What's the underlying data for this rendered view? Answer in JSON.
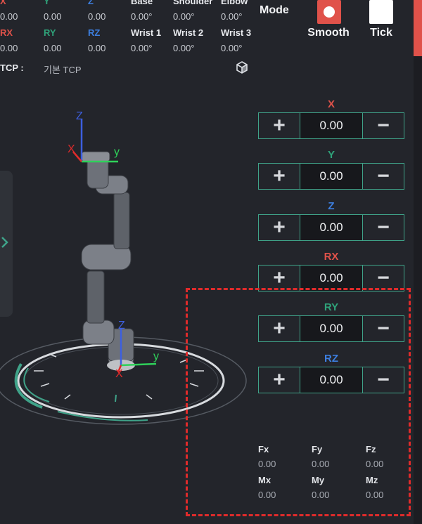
{
  "top_grid": {
    "row1_labels": [
      "X",
      "Y",
      "Z",
      "Base",
      "Shoulder",
      "Elbow"
    ],
    "row1_values": [
      "0.00",
      "0.00",
      "0.00",
      "0.00°",
      "0.00°",
      "0.00°"
    ],
    "row2_labels": [
      "RX",
      "RY",
      "RZ",
      "Wrist 1",
      "Wrist 2",
      "Wrist 3"
    ],
    "row2_values": [
      "0.00",
      "0.00",
      "0.00",
      "0.00°",
      "0.00°",
      "0.00°"
    ]
  },
  "tcp": {
    "label": "TCP :",
    "value": "기본 TCP",
    "icon": "cube-icon"
  },
  "mode": {
    "label": "Mode",
    "options": [
      {
        "label": "Smooth",
        "selected": true
      },
      {
        "label": "Tick",
        "selected": false
      }
    ]
  },
  "robot_view": {
    "tool_axes": {
      "z": "Z",
      "x": "X",
      "y": "y"
    },
    "base_axes": {
      "z": "Z",
      "x": "X",
      "y": "y"
    }
  },
  "jog": [
    {
      "axis": "X",
      "value": "0.00",
      "color": "#e0524a"
    },
    {
      "axis": "Y",
      "value": "0.00",
      "color": "#2fa37a"
    },
    {
      "axis": "Z",
      "value": "0.00",
      "color": "#3d7fe0"
    },
    {
      "axis": "RX",
      "value": "0.00",
      "color": "#e0524a"
    },
    {
      "axis": "RY",
      "value": "0.00",
      "color": "#2fa37a"
    },
    {
      "axis": "RZ",
      "value": "0.00",
      "color": "#3d7fe0"
    }
  ],
  "force_torque": {
    "row1": [
      {
        "label": "Fx",
        "value": "0.00"
      },
      {
        "label": "Fy",
        "value": "0.00"
      },
      {
        "label": "Fz",
        "value": "0.00"
      }
    ],
    "row2": [
      {
        "label": "Mx",
        "value": "0.00"
      },
      {
        "label": "My",
        "value": "0.00"
      },
      {
        "label": "Mz",
        "value": "0.00"
      }
    ]
  },
  "colors": {
    "background": "#23252b",
    "accent_teal": "#3fa389",
    "highlight_red": "#e02b2b"
  }
}
